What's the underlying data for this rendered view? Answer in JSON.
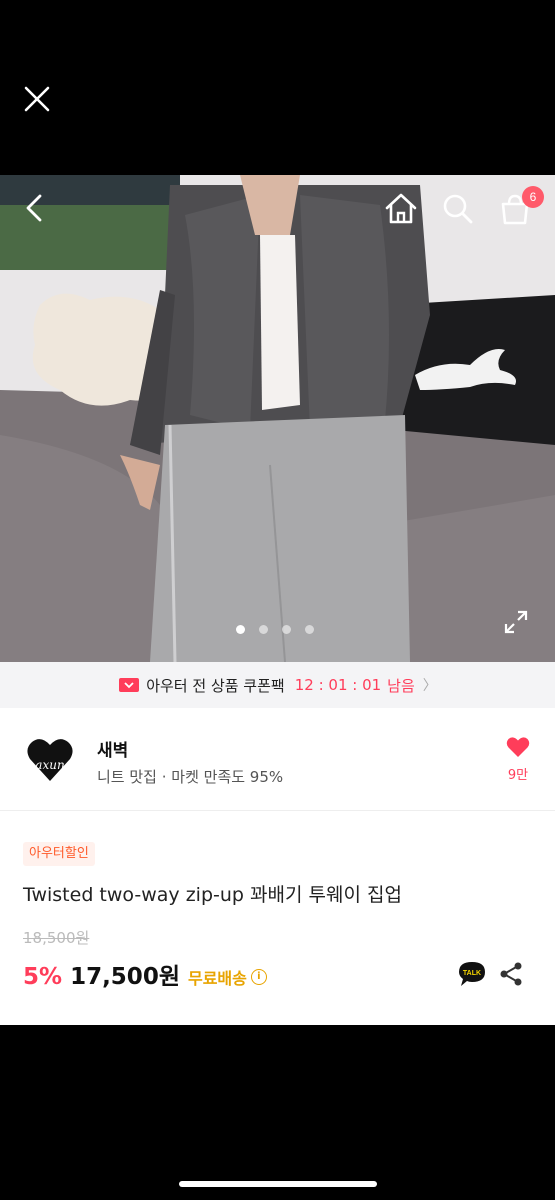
{
  "coupon": {
    "label": "아우터 전 상품 쿠폰팩",
    "timer": "12 : 01 : 01",
    "remain": "남음"
  },
  "cart": {
    "count": "6"
  },
  "gallery": {
    "current": 1,
    "total": 4
  },
  "shop": {
    "logo_text": "axun",
    "name": "새벽",
    "desc": "니트 맛집 · 마켓 만족도 95%",
    "likes": "9만"
  },
  "product": {
    "tag": "아우터할인",
    "title": "Twisted two-way zip-up 꽈배기 투웨이 집업",
    "original_price": "18,500원",
    "discount": "5%",
    "price": "17,500원",
    "shipping": "무료배송",
    "talk_label": "TALK"
  },
  "colors": {
    "accent": "#ff3d5a",
    "shipping": "#e8a400",
    "tag_bg": "#fff1ed",
    "tag_text": "#ff5a2a"
  }
}
